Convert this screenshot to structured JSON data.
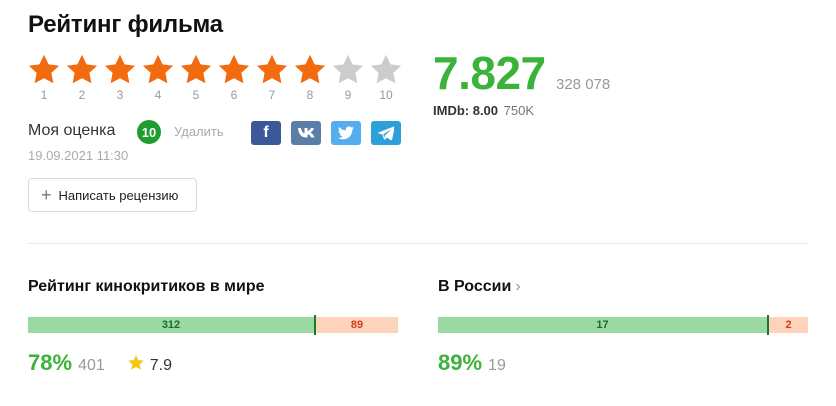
{
  "title": "Рейтинг фильма",
  "stars": {
    "labels": [
      "1",
      "2",
      "3",
      "4",
      "5",
      "6",
      "7",
      "8",
      "9",
      "10"
    ],
    "filled_count": 8,
    "filled_color": "#f26b0f",
    "empty_color": "#cccccc"
  },
  "rating": {
    "value": "7.827",
    "votes": "328 078"
  },
  "imdb": {
    "label": "IMDb: 8.00",
    "count": "750K"
  },
  "my_rating": {
    "label": "Моя оценка",
    "score": "10",
    "delete_label": "Удалить",
    "date": "19.09.2021 11:30"
  },
  "share": [
    {
      "name": "facebook",
      "glyph": "f",
      "color": "#3b5998"
    },
    {
      "name": "vk",
      "glyph": "vk",
      "color": "#5b7ea8"
    },
    {
      "name": "twitter",
      "glyph": "twitter",
      "color": "#55acee"
    },
    {
      "name": "telegram",
      "glyph": "telegram",
      "color": "#2f9fd9"
    }
  ],
  "review_button": {
    "icon": "+",
    "label": "Написать рецензию"
  },
  "critics_world": {
    "title": "Рейтинг кинокритиков в мире",
    "positive": "312",
    "negative": "89",
    "percent": "78%",
    "count": "401",
    "average": "7.9"
  },
  "critics_russia": {
    "title": "В России",
    "chevron": "›",
    "positive": "17",
    "negative": "2",
    "percent": "89%",
    "count": "19"
  },
  "colors": {
    "rating_green": "#3bb33b",
    "bar_positive": "#9ad9a4",
    "bar_negative": "#fdd3b9",
    "avg_star": "#f5c518"
  }
}
